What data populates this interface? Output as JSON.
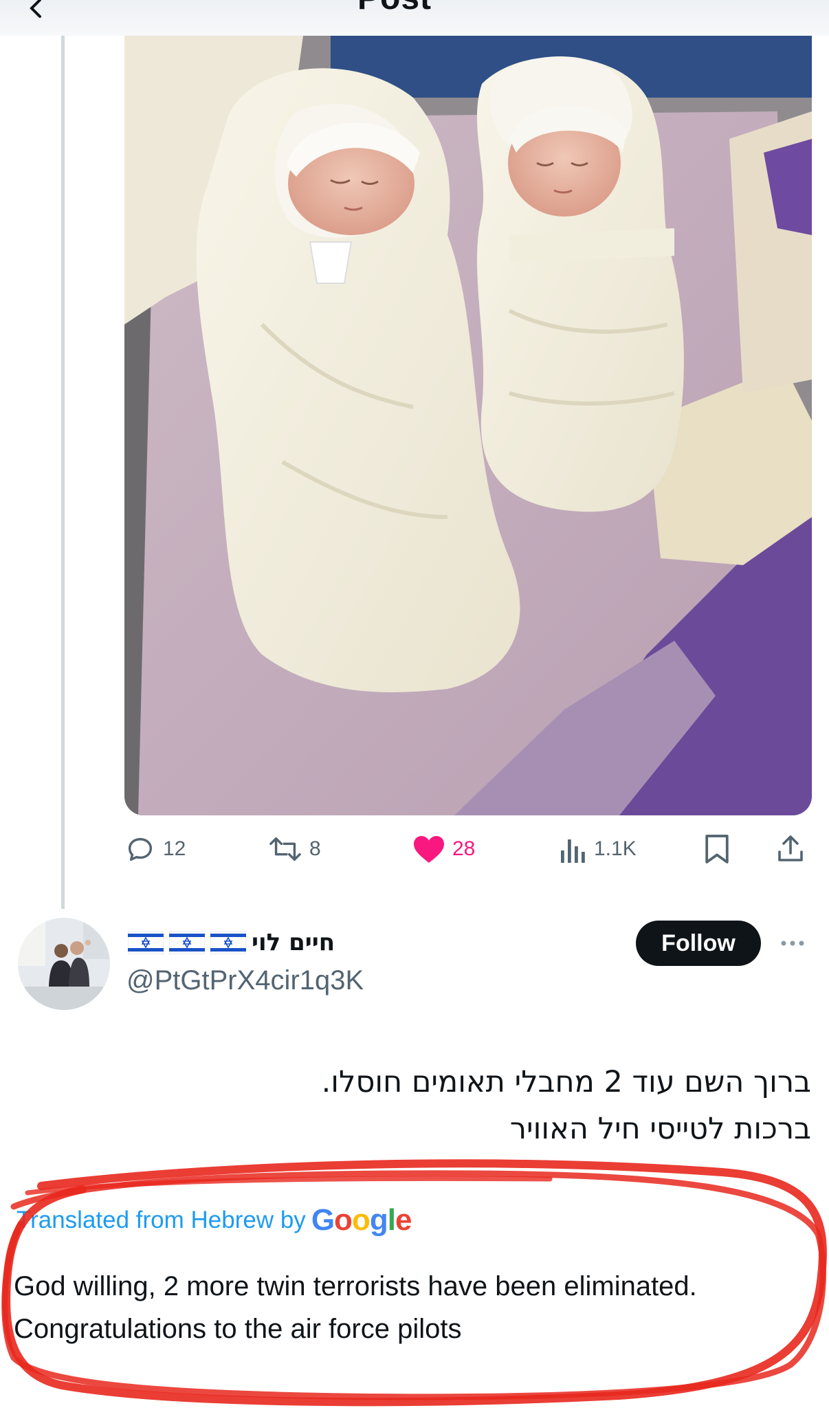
{
  "header": {
    "title": "Post"
  },
  "post": {
    "image_alt": "Two newborn babies swaddled in white blankets lying side by side",
    "actions": {
      "replies": "12",
      "reposts": "8",
      "likes": "28",
      "views": "1.1K"
    },
    "like_color": "#f91880"
  },
  "reply": {
    "author_name": "חיים לוי",
    "flags": [
      "israel-flag",
      "israel-flag",
      "israel-flag"
    ],
    "handle": "@PtGtPrX4cir1q3K",
    "follow_label": "Follow",
    "text_lines": [
      "ברוך השם עוד 2 מחבלי תאומים חוסלו.",
      "ברכות לטייסי חיל האוויר"
    ],
    "translated_label": "Translated from Hebrew by",
    "translator": "Google",
    "translation_lines": [
      "God willing, 2 more twin terrorists have been eliminated.",
      "Congratulations to the air force pilots"
    ]
  },
  "colors": {
    "accent": "#1d9bf0",
    "text": "#0f1419",
    "muted": "#536471",
    "annotation": "#e8281e"
  }
}
